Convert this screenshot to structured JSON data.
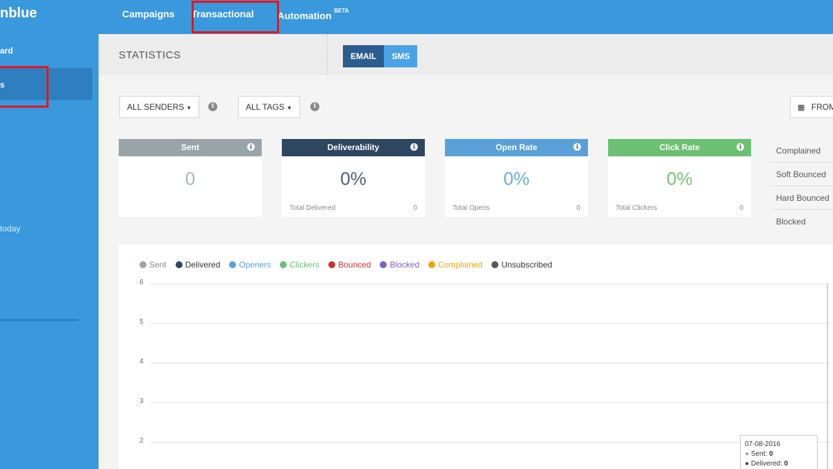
{
  "brand": {
    "name": "nblue"
  },
  "topnav": {
    "items": [
      {
        "label": "Campaigns"
      },
      {
        "label": "Transactional"
      },
      {
        "label": "Automation",
        "badge": "BETA"
      }
    ]
  },
  "sidebar": {
    "dashboard_label": "ard",
    "statistics_label": "s",
    "today_label": "today"
  },
  "header": {
    "title": "STATISTICS",
    "toggle": {
      "email": "EMAIL",
      "sms": "SMS"
    }
  },
  "filters": {
    "senders": "ALL SENDERS",
    "tags": "ALL TAGS",
    "date_from": "FROM"
  },
  "cards": [
    {
      "title": "Sent",
      "value": "0",
      "color": "#98a4a8",
      "value_color": "#aab5b8",
      "foot_label": "",
      "foot_value": ""
    },
    {
      "title": "Deliverability",
      "value": "0%",
      "color": "#2e4660",
      "value_color": "#4b5f74",
      "foot_label": "Total Delivered",
      "foot_value": "0"
    },
    {
      "title": "Open Rate",
      "value": "0%",
      "color": "#5aa0d8",
      "value_color": "#6aacde",
      "foot_label": "Total Opens",
      "foot_value": "0"
    },
    {
      "title": "Click Rate",
      "value": "0%",
      "color": "#6cc072",
      "value_color": "#74c37a",
      "foot_label": "Total Clickers",
      "foot_value": "0"
    }
  ],
  "side_stats": [
    "Complained",
    "Soft Bounced",
    "Hard Bounced",
    "Blocked"
  ],
  "chart_data": {
    "type": "line",
    "legend": [
      {
        "name": "Sent",
        "color": "#9aa5a8"
      },
      {
        "name": "Delivered",
        "color": "#2e4660"
      },
      {
        "name": "Openers",
        "color": "#5aa0d8"
      },
      {
        "name": "Clickers",
        "color": "#6cc072"
      },
      {
        "name": "Bounced",
        "color": "#c9342f"
      },
      {
        "name": "Blocked",
        "color": "#7b5fc4"
      },
      {
        "name": "Complained",
        "color": "#f0a30a"
      },
      {
        "name": "Unsubscribed",
        "color": "#555555"
      }
    ],
    "y_ticks": [
      "6",
      "5",
      "4",
      "3",
      "2"
    ],
    "tooltip": {
      "date": "07-08-2016",
      "rows": [
        {
          "label": "Sent:",
          "value": "0",
          "color": "#9aa5a8"
        },
        {
          "label": "Delivered:",
          "value": "0",
          "color": "#2e4660"
        }
      ]
    }
  }
}
